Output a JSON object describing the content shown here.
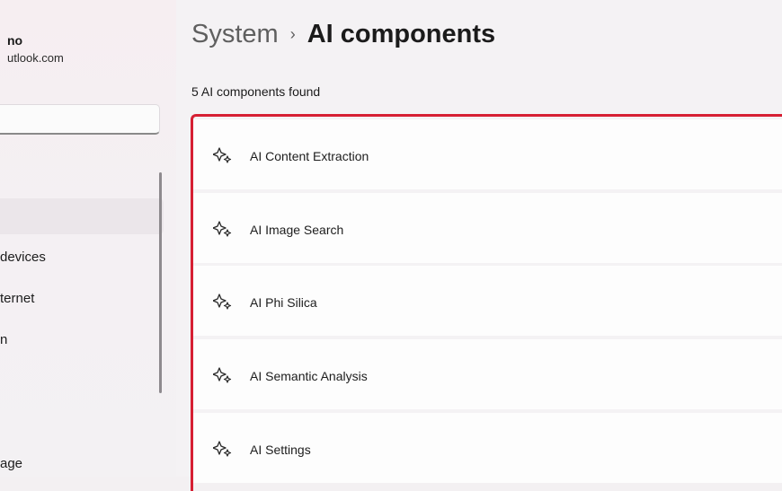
{
  "sidebar": {
    "user_name": "no",
    "user_email": "utlook.com",
    "nav_items": [
      "devices",
      "ternet",
      "n",
      "age"
    ]
  },
  "breadcrumb": {
    "parent": "System",
    "separator": "›",
    "current": "AI components"
  },
  "summary": "5 AI components found",
  "components": [
    {
      "label": "AI Content Extraction",
      "icon": "sparkle-icon"
    },
    {
      "label": "AI Image Search",
      "icon": "sparkle-icon"
    },
    {
      "label": "AI Phi Silica",
      "icon": "sparkle-icon"
    },
    {
      "label": "AI Semantic Analysis",
      "icon": "sparkle-icon"
    },
    {
      "label": "AI Settings",
      "icon": "sparkle-icon"
    }
  ],
  "colors": {
    "highlight_border": "#d61f33",
    "selected_nav_bg": "#ebe6ea"
  }
}
